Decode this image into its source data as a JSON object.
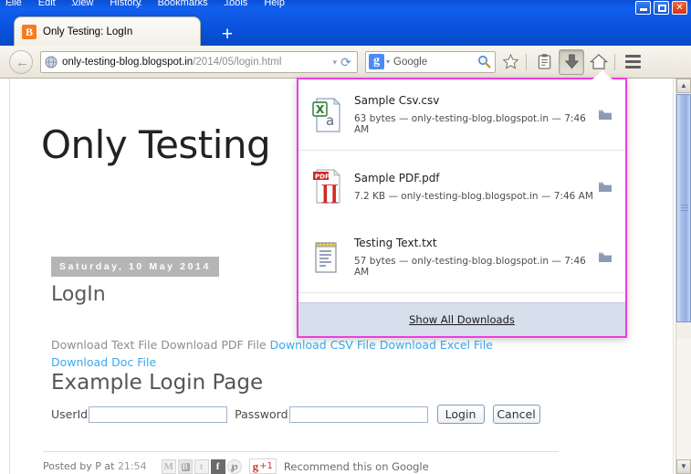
{
  "window": {
    "menu": [
      "File",
      "Edit",
      "View",
      "History",
      "Bookmarks",
      "Tools",
      "Help"
    ],
    "controls": {
      "minimize": "Minimize",
      "maximize": "Maximize",
      "close": "Close"
    }
  },
  "tabs": {
    "active": {
      "title": "Only Testing: LogIn",
      "favicon": "blogger-icon"
    },
    "new_tab_label": "+"
  },
  "toolbar": {
    "back_label": "Back",
    "url_host": "only-testing-blog.blogspot.in",
    "url_path": "/2014/05/login.html",
    "url_dropdown": "▾",
    "reload_label": "⟳",
    "search_engine": "Google",
    "search_value": "",
    "search_caret": "▾",
    "icons": {
      "bookmark": "star-icon",
      "reading_list": "reading-list-icon",
      "downloads": "download-arrow-icon",
      "home": "home-icon",
      "menu": "hamburger-menu-icon"
    }
  },
  "downloads_panel": {
    "accent_border": "#ef3ce0",
    "items": [
      {
        "name": "Sample Csv.csv",
        "details": "63 bytes — only-testing-blog.blogspot.in — 7:46 AM",
        "icon": "csv-file-icon",
        "action": "open-containing-folder"
      },
      {
        "name": "Sample PDF.pdf",
        "details": "7.2 KB — only-testing-blog.blogspot.in — 7:46 AM",
        "icon": "pdf-file-icon",
        "action": "open-containing-folder"
      },
      {
        "name": "Testing Text.txt",
        "details": "57 bytes — only-testing-blog.blogspot.in — 7:46 AM",
        "icon": "txt-file-icon",
        "action": "open-containing-folder"
      }
    ],
    "footer": {
      "accesskey": "S",
      "rest": "how All Downloads",
      "full": "Show All Downloads"
    }
  },
  "page": {
    "blog_title": "Only Testing",
    "date_banner": "Saturday, 10 May 2014",
    "post_title": "LogIn",
    "download_links": [
      {
        "label": "Download Text File",
        "state": "visited"
      },
      {
        "label": "Download PDF File",
        "state": "visited"
      },
      {
        "label": "Download CSV File",
        "state": "hover"
      },
      {
        "label": "Download Excel File",
        "state": "normal"
      },
      {
        "label": "Download Doc File",
        "state": "normal"
      }
    ],
    "form": {
      "heading": "Example Login Page",
      "userid_label": "UserId",
      "userid_value": "",
      "password_label": "Password",
      "password_value": "",
      "login_button": "Login",
      "cancel_button": "Cancel"
    },
    "footer": {
      "posted_by": "Posted by P at ",
      "time": "21:54",
      "share": [
        "gmail-icon",
        "blogger-icon",
        "twitter-icon",
        "facebook-icon",
        "pinterest-icon"
      ],
      "gplus_g": "g",
      "gplus_plus": "+1",
      "recommend": "Recommend this on Google"
    }
  },
  "colors": {
    "titlebar_blue": "#0b54e0",
    "link_blue": "#3aa9ee",
    "visited_gray": "#8d8d8d",
    "popup_border": "#ef3ce0",
    "banner_gray": "#b5b5b5"
  }
}
